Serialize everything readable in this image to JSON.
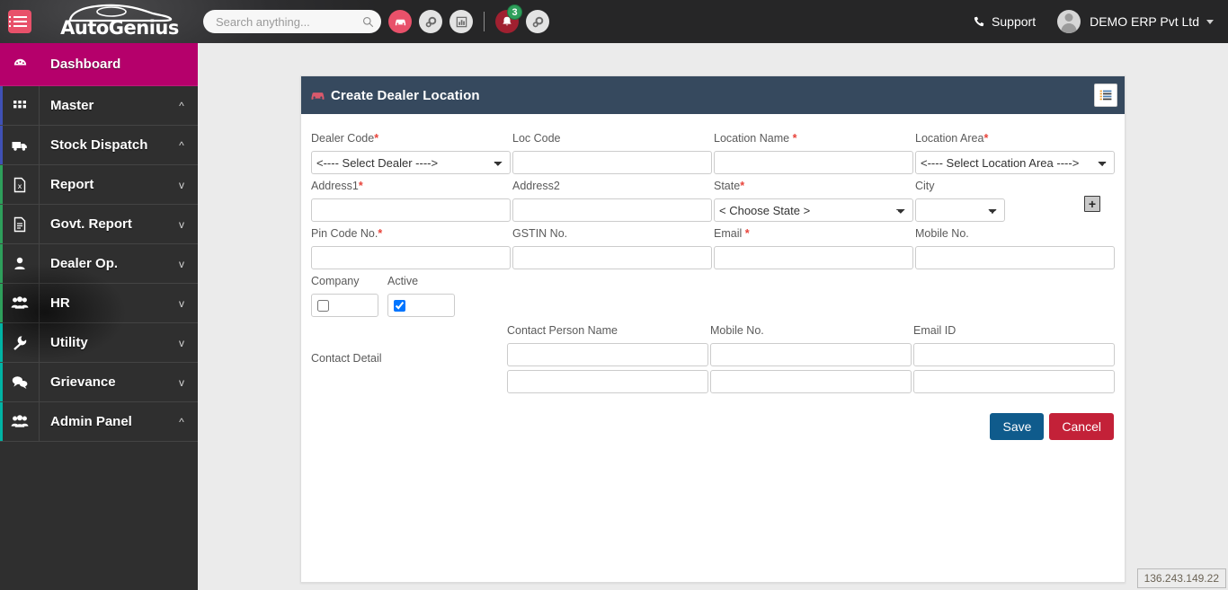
{
  "header": {
    "menu_toggle_icon": "hamburger-list-icon",
    "brand_name": "AutoGenius",
    "search": {
      "placeholder": "Search anything...",
      "value": ""
    },
    "icons": [
      {
        "name": "car-icon",
        "style": "car"
      },
      {
        "name": "gears-icon",
        "style": "grey"
      },
      {
        "name": "bar-chart-icon",
        "style": "grey"
      }
    ],
    "notification": {
      "icon": "bell-icon",
      "count": "3"
    },
    "settings_icon": "gears-settings-icon",
    "support_label": "Support",
    "support_icon": "phone-icon",
    "user_name": "DEMO ERP Pvt Ltd",
    "avatar_icon": "user-avatar-icon"
  },
  "sidebar": {
    "items": [
      {
        "label": "Dashboard",
        "icon": "dashboard-gauge-icon",
        "chevron": "",
        "active": true,
        "accent": "#b5006b"
      },
      {
        "label": "Master",
        "icon": "grid-icon",
        "chevron": "^",
        "active": false,
        "accent": "#3f51b5"
      },
      {
        "label": "Stock Dispatch",
        "icon": "truck-icon",
        "chevron": "^",
        "active": false,
        "accent": "#3f51b5"
      },
      {
        "label": "Report",
        "icon": "excel-file-icon",
        "chevron": "v",
        "active": false,
        "accent": "#2e9f5b"
      },
      {
        "label": "Govt. Report",
        "icon": "document-icon",
        "chevron": "v",
        "active": false,
        "accent": "#2e9f5b"
      },
      {
        "label": "Dealer Op.",
        "icon": "user-icon",
        "chevron": "v",
        "active": false,
        "accent": "#2e9f5b"
      },
      {
        "label": "HR",
        "icon": "users-group-icon",
        "chevron": "v",
        "active": false,
        "accent": "#2e9f5b"
      },
      {
        "label": "Utility",
        "icon": "wrench-icon",
        "chevron": "v",
        "active": false,
        "accent": "#00b3a4"
      },
      {
        "label": "Grievance",
        "icon": "chat-bubble-icon",
        "chevron": "v",
        "active": false,
        "accent": "#00b3a4"
      },
      {
        "label": "Admin Panel",
        "icon": "users-group-icon",
        "chevron": "^",
        "active": false,
        "accent": "#00b3a4"
      }
    ]
  },
  "panel": {
    "title": "Create Dealer Location",
    "title_icon": "car-icon",
    "header_button_icon": "list-view-icon"
  },
  "form": {
    "row1": {
      "dealer_code": {
        "label": "Dealer Code",
        "required": true,
        "value": "<---- Select Dealer ---->"
      },
      "loc_code": {
        "label": "Loc Code",
        "required": false,
        "value": ""
      },
      "location_name": {
        "label": "Location Name",
        "required": true,
        "value": ""
      },
      "location_area": {
        "label": "Location Area",
        "required": true,
        "value": "<---- Select Location Area ---->"
      }
    },
    "row2": {
      "address1": {
        "label": "Address1",
        "required": true,
        "value": ""
      },
      "address2": {
        "label": "Address2",
        "required": false,
        "value": ""
      },
      "state": {
        "label": "State",
        "required": true,
        "value": "< Choose State >"
      },
      "city": {
        "label": "City",
        "required": false,
        "value": ""
      },
      "add_button_label": "+"
    },
    "row3": {
      "pin_code": {
        "label": "Pin Code No.",
        "required": true,
        "value": ""
      },
      "gstin_no": {
        "label": "GSTIN No.",
        "required": false,
        "value": ""
      },
      "email": {
        "label": "Email",
        "required": true,
        "value": ""
      },
      "mobile_no": {
        "label": "Mobile No.",
        "required": false,
        "value": ""
      }
    },
    "row4": {
      "company": {
        "label": "Company",
        "checked": false
      },
      "active": {
        "label": "Active",
        "checked": true
      }
    },
    "contact": {
      "section_label": "Contact Detail",
      "columns": [
        "Contact Person Name",
        "Mobile No.",
        "Email ID"
      ],
      "rows": [
        {
          "person_name": "",
          "mobile_no": "",
          "email_id": ""
        },
        {
          "person_name": "",
          "mobile_no": "",
          "email_id": ""
        }
      ]
    },
    "buttons": {
      "save": "Save",
      "cancel": "Cancel"
    }
  },
  "status": {
    "ip_address": "136.243.149.22"
  }
}
